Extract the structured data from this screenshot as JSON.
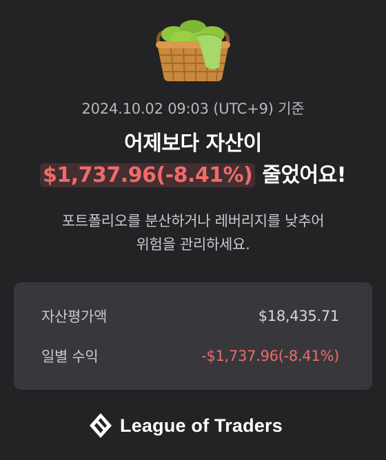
{
  "icons": {
    "hero": "basket-of-limes-icon",
    "brand": "league-of-traders-logo-icon"
  },
  "colors": {
    "background": "#232325",
    "card": "#38383c",
    "loss": "#ef6b6b"
  },
  "header": {
    "timestamp": "2024.10.02 09:03 (UTC+9) 기준"
  },
  "headline": {
    "line1": "어제보다 자산이",
    "loss_amount": "$1,737.96(-8.41%)",
    "line2_suffix": "줄었어요!"
  },
  "advice": {
    "line1": "포트폴리오를 분산하거나 레버리지를 낮추어",
    "line2": "위험을 관리하세요."
  },
  "summary": {
    "rows": [
      {
        "label": "자산평가액",
        "value": "$18,435.71"
      },
      {
        "label": "일별 수익",
        "value": "-$1,737.96(-8.41%)"
      }
    ]
  },
  "footer": {
    "brand_name": "League of Traders"
  }
}
